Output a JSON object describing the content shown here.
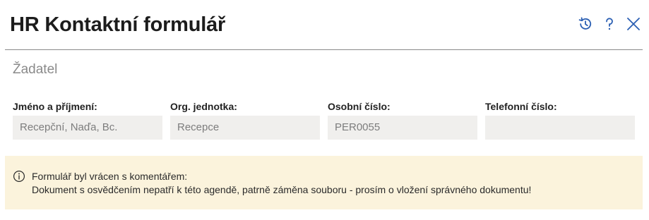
{
  "header": {
    "title": "HR Kontaktní formulář",
    "actions": [
      {
        "icon": "history-icon"
      },
      {
        "icon": "help-icon"
      },
      {
        "icon": "close-icon"
      }
    ],
    "accent_color": "#2b5fb3"
  },
  "section": {
    "title": "Žadatel"
  },
  "fields": [
    {
      "label": "Jméno a příjmení:",
      "value": "Recepční, Naďa, Bc."
    },
    {
      "label": "Org. jednotka:",
      "value": "Recepce"
    },
    {
      "label": "Osobní číslo:",
      "value": "PER0055"
    },
    {
      "label": "Telefonní číslo:",
      "value": ""
    }
  ],
  "notice": {
    "icon": "info-icon",
    "line1": "Formulář byl vrácen s komentářem:",
    "line2": "Dokument s osvědčením nepatří k této agendě, patrně záměna souboru - prosím o vložení správného dokumentu!",
    "background": "#fbf3dc"
  }
}
